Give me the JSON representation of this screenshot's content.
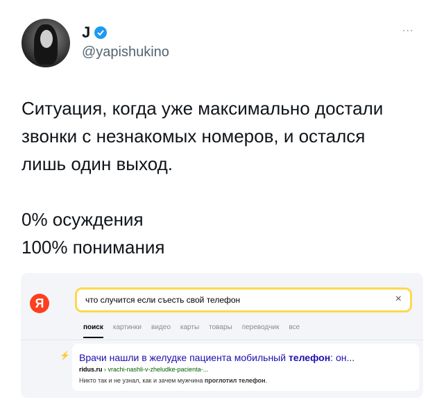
{
  "tweet": {
    "author_name": "J",
    "handle": "@yapishukino",
    "more_label": "...",
    "lines": [
      "Ситуация, когда уже максимально достали",
      "звонки с незнакомых номеров, и остался",
      "лишь один выход."
    ],
    "stats": [
      "0% осуждения",
      "100% понимания"
    ]
  },
  "search": {
    "logo_letter": "Я",
    "query": "что случится если съесть свой телефон",
    "clear_label": "×",
    "tabs": [
      "поиск",
      "картинки",
      "видео",
      "карты",
      "товары",
      "переводчик",
      "все"
    ],
    "result": {
      "title_prefix": "Врачи нашли в желудке пациента мобильный",
      "title_bold": "телефон",
      "title_suffix": ": он...",
      "url_domain": "ridus.ru",
      "url_path": " › vrachi-nashli-v-zheludke-pacienta-...",
      "snippet_prefix": "Никто так и не узнал, как и зачем мужчина",
      "snippet_bold": "проглотил телефон",
      "snippet_suffix": "."
    }
  },
  "colors": {
    "verified": "#1d9bf0",
    "yandex_red": "#fc3f1d",
    "search_border": "#ffd84d"
  }
}
